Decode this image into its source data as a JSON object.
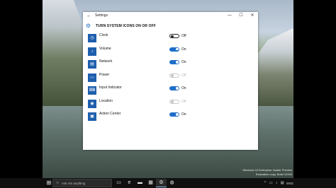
{
  "window": {
    "title": "Settings",
    "back_icon": "back-arrow-icon",
    "min_icon": "minimize-icon",
    "max_icon": "maximize-icon",
    "close_icon": "close-icon"
  },
  "header": {
    "icon": "gear-icon",
    "title": "TURN SYSTEM ICONS ON OR OFF"
  },
  "items": [
    {
      "label": "Clock",
      "state": "Off",
      "icon": "clock-icon",
      "enabled": true
    },
    {
      "label": "Volume",
      "state": "On",
      "icon": "volume-icon",
      "enabled": true
    },
    {
      "label": "Network",
      "state": "On",
      "icon": "network-icon",
      "enabled": true
    },
    {
      "label": "Power",
      "state": "Off",
      "icon": "power-icon",
      "enabled": false
    },
    {
      "label": "Input Indicator",
      "state": "On",
      "icon": "keyboard-icon",
      "enabled": true
    },
    {
      "label": "Location",
      "state": "Off",
      "icon": "location-icon",
      "enabled": false
    },
    {
      "label": "Action Center",
      "state": "On",
      "icon": "action-center-icon",
      "enabled": true
    }
  ],
  "desktop": {
    "watermark_line1": "Windows 10 Enterprise Insider Preview",
    "watermark_line2": "Evaluation copy. Build 10130"
  },
  "taskbar": {
    "search_placeholder": "Ask me anything",
    "language": "ENG"
  },
  "colors": {
    "accent": "#1e6ec8",
    "tile": "#1e5fad",
    "taskbar": "#101010"
  }
}
